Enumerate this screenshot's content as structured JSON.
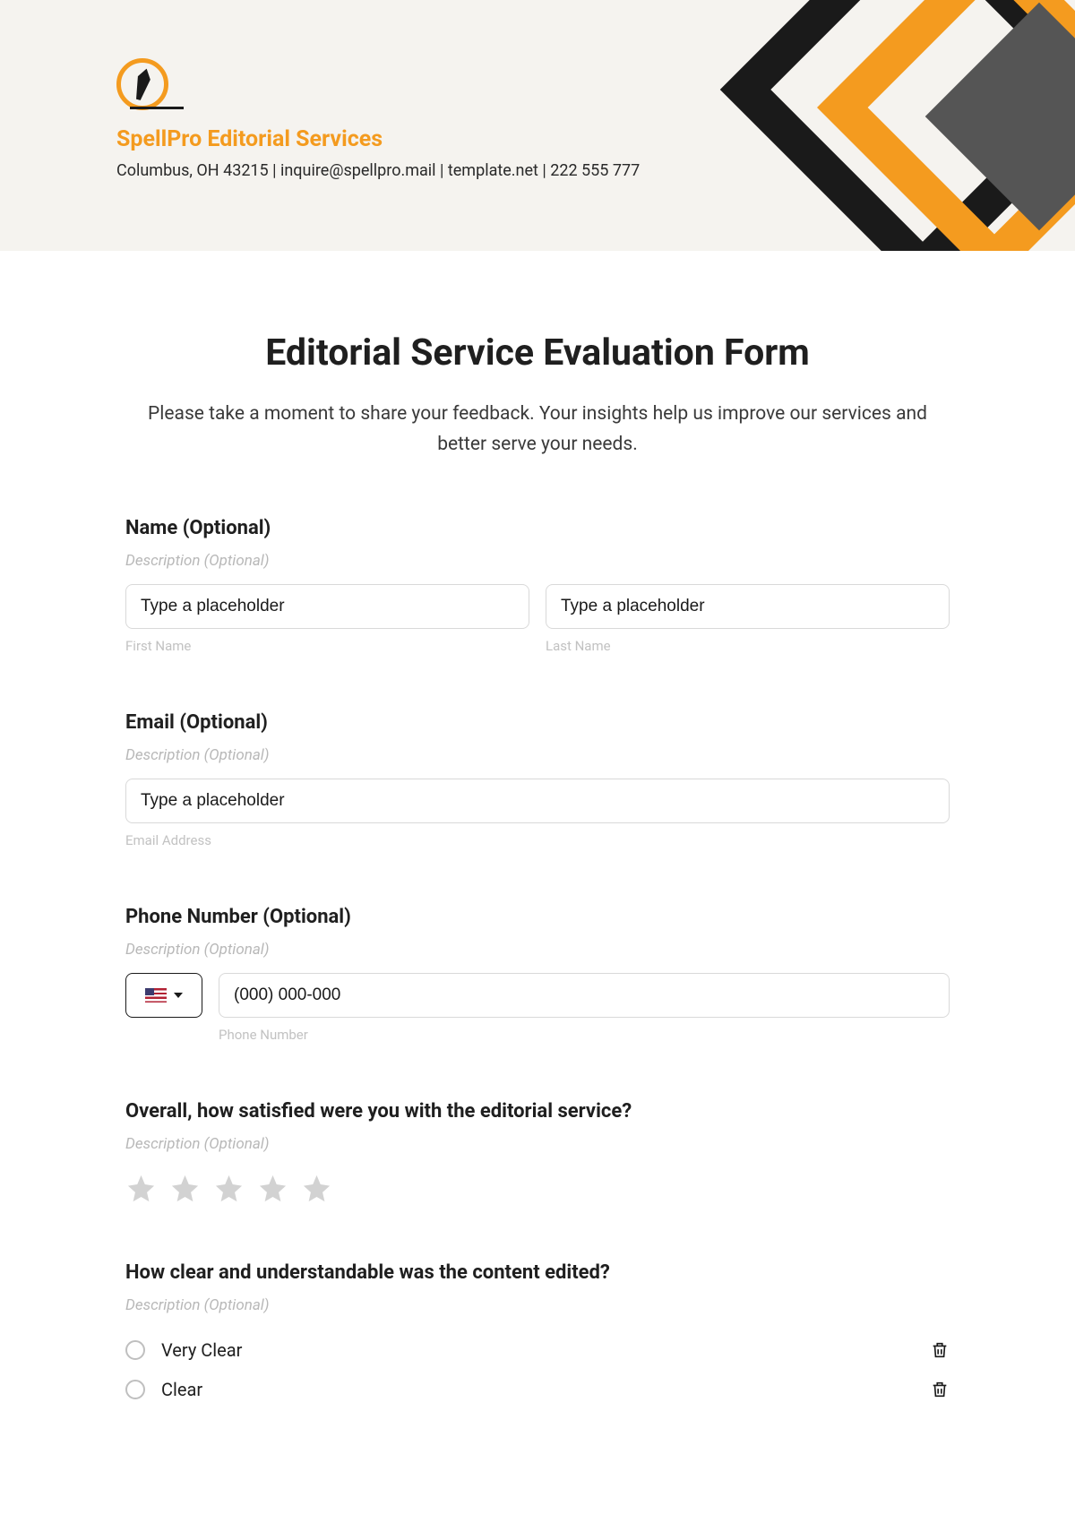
{
  "header": {
    "company_name": "SpellPro Editorial Services",
    "company_info": "Columbus, OH 43215 | inquire@spellpro.mail | template.net | 222 555 777"
  },
  "form": {
    "title": "Editorial Service Evaluation Form",
    "intro": "Please take a moment to share your feedback. Your insights help us improve our services and better serve your needs."
  },
  "name": {
    "label": "Name (Optional)",
    "desc": "Description (Optional)",
    "first_placeholder": "Type a placeholder",
    "first_sub": "First Name",
    "last_placeholder": "Type a placeholder",
    "last_sub": "Last Name"
  },
  "email": {
    "label": "Email (Optional)",
    "desc": "Description (Optional)",
    "placeholder": "Type a placeholder",
    "sub": "Email Address"
  },
  "phone": {
    "label": "Phone Number (Optional)",
    "desc": "Description (Optional)",
    "placeholder": "(000) 000-000",
    "sub": "Phone Number"
  },
  "satisfaction": {
    "label": "Overall, how satisfied were you with the editorial service?",
    "desc": "Description (Optional)"
  },
  "clarity": {
    "label": "How clear and understandable was the content edited?",
    "desc": "Description (Optional)",
    "options": [
      "Very Clear",
      "Clear"
    ]
  }
}
